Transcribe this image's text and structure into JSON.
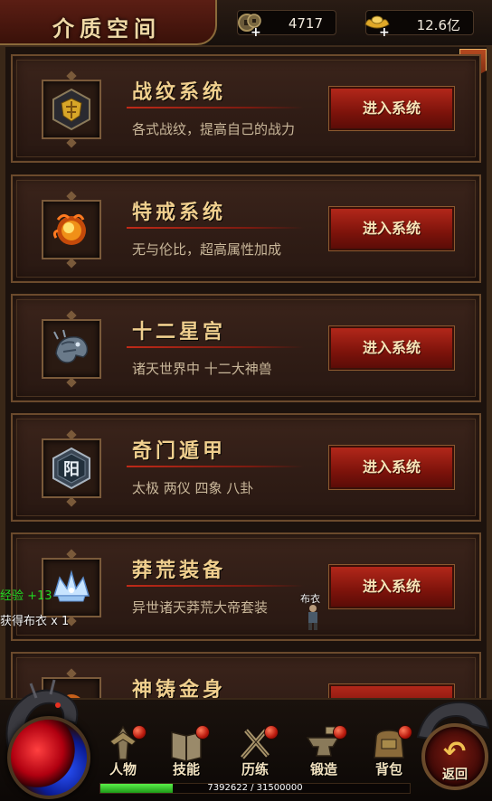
{
  "header": {
    "title": "介质空间",
    "coin_value": "4717",
    "ingot_value": "12.6亿",
    "coin_icon": "copper-coin-icon",
    "ingot_icon": "gold-ingot-icon"
  },
  "close_label": "✕",
  "cards": [
    {
      "title": "战纹系统",
      "desc": "各式战纹，提高自己的战力",
      "button": "进入系统",
      "icon": "battle-emblem-icon"
    },
    {
      "title": "特戒系统",
      "desc": "无与伦比，超高属性加成",
      "button": "进入系统",
      "icon": "fire-ring-icon"
    },
    {
      "title": "十二星宫",
      "desc": "诸天世界中 十二大神兽",
      "button": "进入系统",
      "icon": "dragon-head-icon"
    },
    {
      "title": "奇门遁甲",
      "desc": "太极 两仪 四象 八卦",
      "button": "进入系统",
      "icon": "yang-hexagon-icon"
    },
    {
      "title": "莽荒装备",
      "desc": "异世诸天莽荒大帝套装",
      "button": "进入系统",
      "icon": "crystal-crown-icon"
    },
    {
      "title": "神铸金身",
      "desc": "",
      "button": "",
      "icon": "golden-body-icon"
    }
  ],
  "floating": {
    "exp": "经验 +13",
    "obtained": "获得布衣 x 1",
    "npc_label": "布衣"
  },
  "bottom_menu": [
    {
      "label": "人物",
      "icon": "character-icon"
    },
    {
      "label": "技能",
      "icon": "skill-book-icon"
    },
    {
      "label": "历练",
      "icon": "training-icon"
    },
    {
      "label": "锻造",
      "icon": "anvil-icon"
    },
    {
      "label": "背包",
      "icon": "bag-icon"
    }
  ],
  "return_label": "返回",
  "xp": {
    "text": "7392622 / 31500000",
    "current": 7392622,
    "max": 31500000
  },
  "colors": {
    "button_red": "#9a1a10",
    "title_gold": "#f0cf8e",
    "exp_green": "#22d722"
  }
}
